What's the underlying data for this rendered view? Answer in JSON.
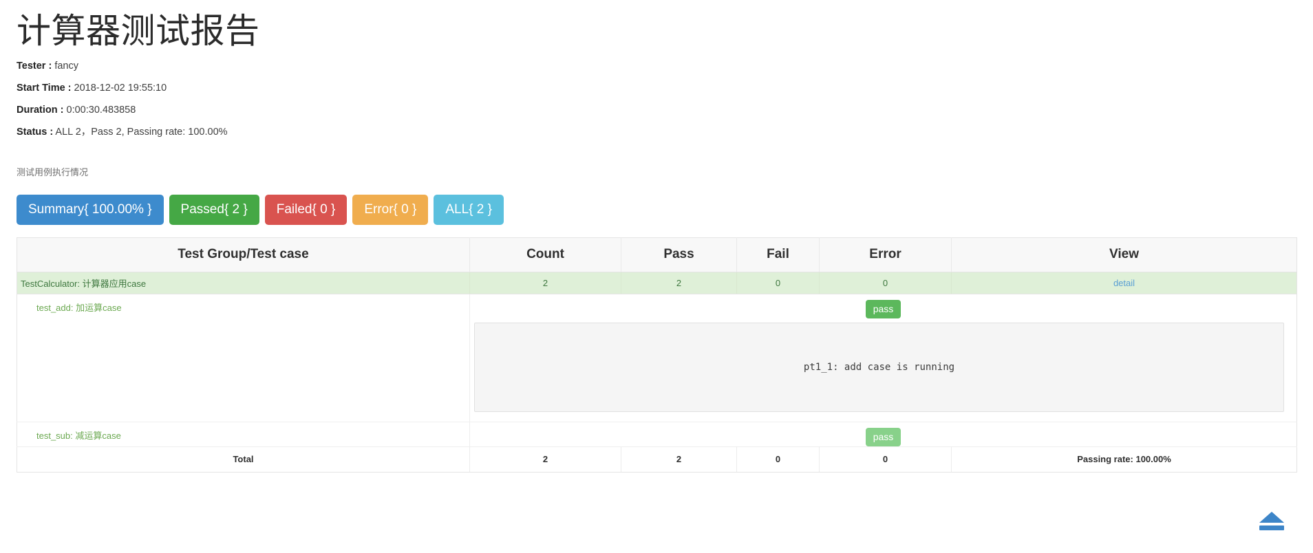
{
  "report": {
    "title": "计算器测试报告",
    "meta": [
      {
        "label": "Tester :",
        "value": "fancy"
      },
      {
        "label": "Start Time :",
        "value": "2018-12-02 19:55:10"
      },
      {
        "label": "Duration :",
        "value": "0:00:30.483858"
      },
      {
        "label": "Status :",
        "value": "ALL 2，Pass 2, Passing rate: 100.00%"
      }
    ],
    "section_caption": "测试用例执行情况"
  },
  "filters": [
    {
      "id": "summary",
      "label": "Summary{ 100.00% }",
      "color": "#3d8bcd"
    },
    {
      "id": "passed",
      "label": "Passed{ 2 }",
      "color": "#45a845"
    },
    {
      "id": "failed",
      "label": "Failed{ 0 }",
      "color": "#d9534f"
    },
    {
      "id": "error",
      "label": "Error{ 0 }",
      "color": "#f0ad4e"
    },
    {
      "id": "all",
      "label": "ALL{ 2 }",
      "color": "#5bc0de"
    }
  ],
  "table": {
    "headers": {
      "name": "Test Group/Test case",
      "count": "Count",
      "pass": "Pass",
      "fail": "Fail",
      "error": "Error",
      "view": "View"
    },
    "group": {
      "name": "TestCalculator: 计算器应用case",
      "count": "2",
      "pass": "2",
      "fail": "0",
      "error": "0",
      "view_link": "detail"
    },
    "cases": [
      {
        "name": "test_add: 加运算case",
        "status": "pass",
        "output": "pt1_1: add case is running",
        "has_output": true
      },
      {
        "name": "test_sub: 减运算case",
        "status": "pass",
        "output": "",
        "has_output": false
      }
    ],
    "total": {
      "label": "Total",
      "count": "2",
      "pass": "2",
      "fail": "0",
      "error": "0",
      "rate": "Passing rate: 100.00%"
    }
  },
  "back_to_top": {
    "icon": "eject-icon"
  }
}
